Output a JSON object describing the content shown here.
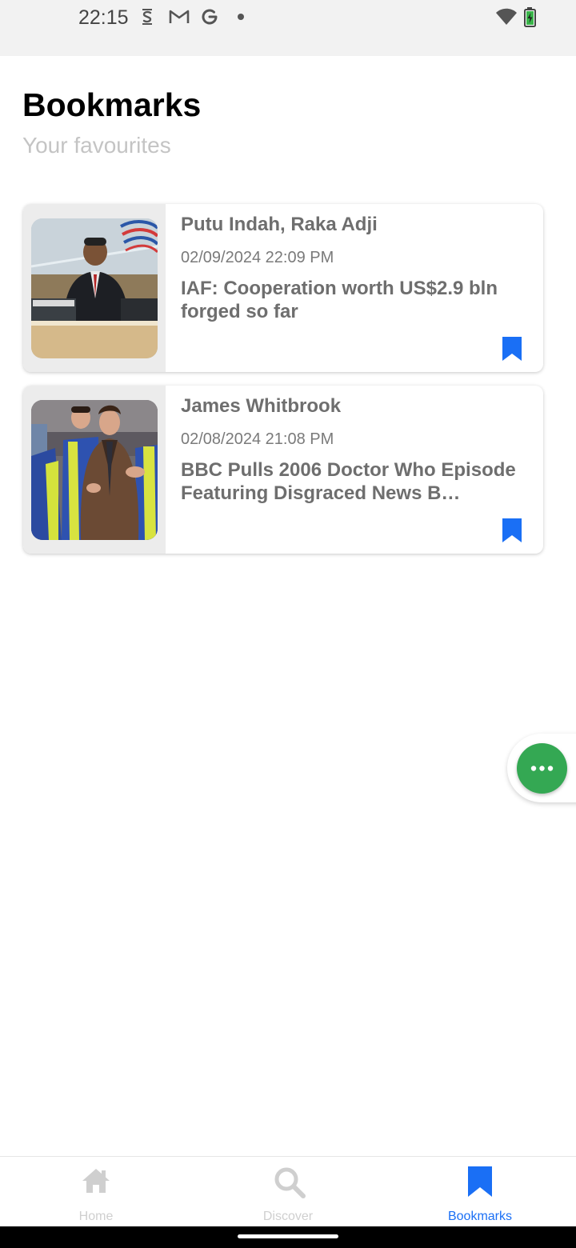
{
  "status_bar": {
    "time": "22:15",
    "icons": [
      "s-notification-icon",
      "gmail-icon",
      "google-icon",
      "notification-dot-icon",
      "wifi-icon",
      "battery-charging-icon"
    ]
  },
  "header": {
    "title": "Bookmarks",
    "subtitle": "Your favourites"
  },
  "bookmarks": [
    {
      "author": "Putu Indah, Raka Adji",
      "date": "02/09/2024 22:09 PM",
      "headline": "IAF: Cooperation worth US$2.9 bln forged so far",
      "bookmarked_icon": "bookmark-filled-icon"
    },
    {
      "author": "James Whitbrook",
      "date": "02/08/2024 21:08 PM",
      "headline": "BBC Pulls 2006 Doctor Who Episode Featuring Disgraced News B…",
      "bookmarked_icon": "bookmark-filled-icon"
    }
  ],
  "fab": {
    "icon": "more-horizontal-icon",
    "color": "#34a853"
  },
  "bottom_nav": {
    "items": [
      {
        "label": "Home",
        "icon": "home-icon",
        "active": false
      },
      {
        "label": "Discover",
        "icon": "search-icon",
        "active": false
      },
      {
        "label": "Bookmarks",
        "icon": "bookmark-icon",
        "active": true
      }
    ],
    "active_color": "#1a6ff5",
    "inactive_color": "#cfcfcf"
  },
  "colors": {
    "accent": "#1a6ff5",
    "status_bar_bg": "#f2f2f2",
    "text_muted": "#6e6e6e"
  }
}
